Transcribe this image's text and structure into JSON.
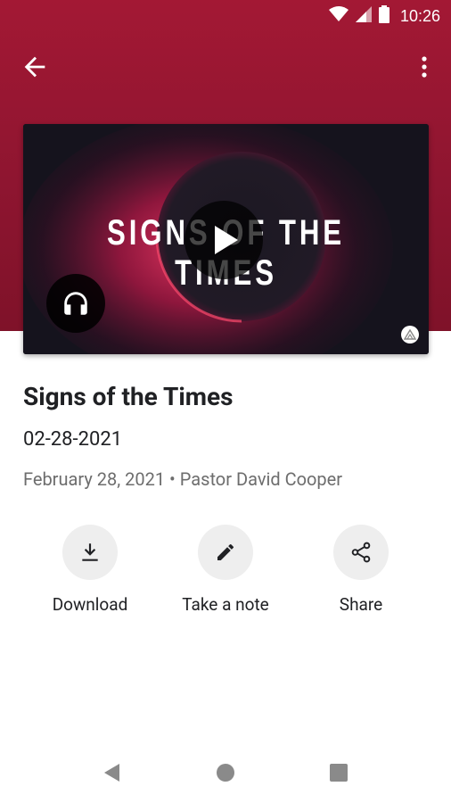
{
  "status_bar": {
    "time": "10:26",
    "icons": [
      "wifi-icon",
      "signal-icon",
      "battery-icon"
    ]
  },
  "app_bar": {
    "back_icon": "arrow-left-icon",
    "menu_icon": "more-vert-icon"
  },
  "video": {
    "artwork_title": "SIGNS OF THE TIMES",
    "play_icon": "play-icon",
    "audio_icon": "headphones-icon"
  },
  "sermon": {
    "title": "Signs of the Times",
    "date": "02-28-2021",
    "meta": "February 28, 2021 • Pastor David Cooper"
  },
  "actions": [
    {
      "label": "Download",
      "icon": "download-icon"
    },
    {
      "label": "Take a note",
      "icon": "pencil-icon"
    },
    {
      "label": "Share",
      "icon": "share-icon"
    }
  ],
  "nav_bar": {
    "icons": [
      "back-triangle-icon",
      "home-circle-icon",
      "recents-square-icon"
    ]
  },
  "colors": {
    "hero": "#9b1733",
    "action_bg": "#eeeeee",
    "meta_text": "#6d6d6d"
  }
}
